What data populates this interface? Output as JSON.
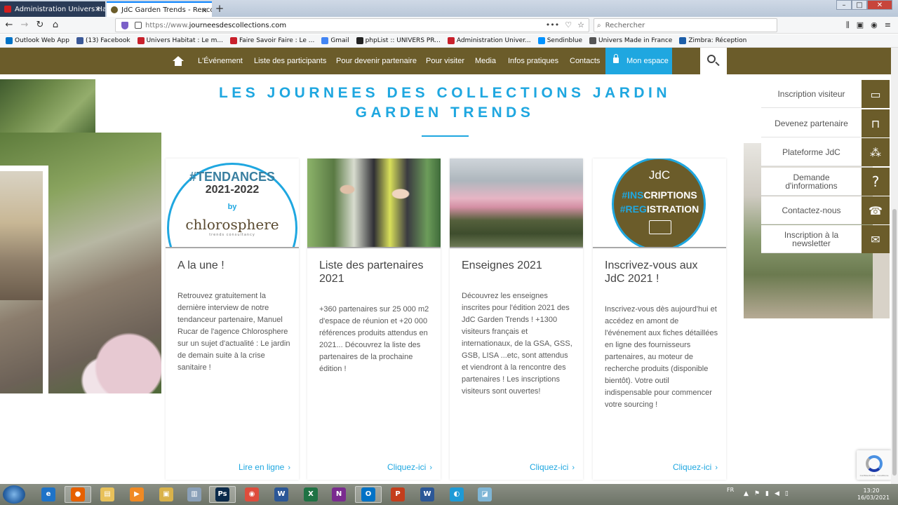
{
  "browser": {
    "tabs": [
      {
        "title": "Administration Univers Habitat",
        "close": "×"
      },
      {
        "title": "JdC Garden Trends - Rencontre",
        "close": "×"
      }
    ],
    "new_tab": "+",
    "url_proto": "https://www.",
    "url_domain": "journeesdescollections.com",
    "url_actions": [
      "•••",
      "♡",
      "☆"
    ],
    "search_placeholder": "Rechercher",
    "window_controls": [
      "–",
      "□",
      "✕"
    ],
    "bookmarks": [
      {
        "label": "Outlook Web App",
        "color": "#0072c6"
      },
      {
        "label": "(13) Facebook",
        "color": "#3b5998"
      },
      {
        "label": "Univers Habitat : Le m...",
        "color": "#c8202b"
      },
      {
        "label": "Faire Savoir Faire : Le ...",
        "color": "#c8202b"
      },
      {
        "label": "Gmail",
        "color": "#4285f4"
      },
      {
        "label": "phpList :: UNIVERS PR...",
        "color": "#222222"
      },
      {
        "label": "Administration Univer...",
        "color": "#c8202b"
      },
      {
        "label": "Sendinblue",
        "color": "#0092ff"
      },
      {
        "label": "Univers Made in France",
        "color": "#555555"
      },
      {
        "label": "Zimbra: Réception",
        "color": "#1d5ea8"
      }
    ]
  },
  "menu": {
    "items": [
      "L'Événement",
      "Liste des participants",
      "Pour devenir partenaire",
      "Pour visiter",
      "Media",
      "Infos pratiques",
      "Contacts"
    ],
    "account": "Mon espace"
  },
  "heading": {
    "line1": "LES JOURNEES DES COLLECTIONS JARDIN",
    "line2": "GARDEN TRENDS"
  },
  "cards": [
    {
      "title": "A la une !",
      "text": "Retrouvez gratuitement la dernière interview de notre tendanceur partenaire, Manuel Rucar de l'agence Chlorosphere sur un sujet d'actualité : Le jardin de demain suite à la crise sanitaire !",
      "cta": "Lire en ligne",
      "image": {
        "hash": "#TENDANCES",
        "years": "2021-2022",
        "by": "by",
        "brand": "chlorosphere",
        "sub": "trends consultancy"
      }
    },
    {
      "title": "Liste des partenaires 2021",
      "text": "+360 partenaires sur 25 000 m2 d'espace de réunion et +20 000 références produits attendus en 2021... Découvrez la liste des partenaires de la prochaine édition !",
      "cta": "Cliquez-ici"
    },
    {
      "title": "Enseignes 2021",
      "text": "Découvrez les enseignes inscrites pour l'édition 2021 des JdC Garden Trends ! +1300 visiteurs français et internationaux, de la GSA, GSS, GSB, LISA ...etc, sont attendus et viendront à la rencontre des partenaires ! Les inscriptions visiteurs sont ouvertes!",
      "cta": "Cliquez-ici"
    },
    {
      "title": "Inscrivez-vous aux JdC 2021 !",
      "text": "Inscrivez-vous dès aujourd'hui et accédez en amont de l'événement aux fiches détaillées en ligne des fournisseurs partenaires, au moteur de recherche produits (disponible bientôt). Votre outil indispensable pour commencer votre sourcing !",
      "cta": "Cliquez-ici",
      "image": {
        "logo": "JdC",
        "line1_hash": "#INS",
        "line1_rest": "CRIPTIONS",
        "line2_hash": "#REG",
        "line2_rest": "ISTRATION"
      }
    }
  ],
  "side_panel": [
    {
      "label": "Inscription visiteur",
      "icon": "id-card-icon"
    },
    {
      "label": "Devenez partenaire",
      "icon": "stand-icon"
    },
    {
      "label": "Plateforme JdC",
      "icon": "network-icon"
    },
    {
      "label": "Demande d'informations",
      "icon": "question-icon"
    },
    {
      "label": "Contactez-nous",
      "icon": "phone-icon"
    },
    {
      "label": "Inscription à la newsletter",
      "icon": "mail-icon"
    }
  ],
  "recaptcha": {
    "text": "Confidentialité - Conditions"
  },
  "taskbar": {
    "icons": [
      {
        "name": "ie",
        "glyph": "e",
        "color": "#1e73c8"
      },
      {
        "name": "firefox",
        "glyph": "●",
        "color": "#e66000",
        "active": true
      },
      {
        "name": "explorer",
        "glyph": "▤",
        "color": "#e8c15a"
      },
      {
        "name": "media",
        "glyph": "▶",
        "color": "#f08a24"
      },
      {
        "name": "archive",
        "glyph": "▣",
        "color": "#d9b24a"
      },
      {
        "name": "documents",
        "glyph": "▥",
        "color": "#8aa0b8"
      },
      {
        "name": "photoshop",
        "glyph": "Ps",
        "color": "#0b2a4a",
        "active": true
      },
      {
        "name": "chrome",
        "glyph": "◉",
        "color": "#de4c3c"
      },
      {
        "name": "word-old",
        "glyph": "W",
        "color": "#2b5797"
      },
      {
        "name": "excel",
        "glyph": "X",
        "color": "#1f7244"
      },
      {
        "name": "onenote",
        "glyph": "N",
        "color": "#7a2b8f"
      },
      {
        "name": "outlook",
        "glyph": "O",
        "color": "#0072c6",
        "active": true
      },
      {
        "name": "powerpoint",
        "glyph": "P",
        "color": "#c43e1c"
      },
      {
        "name": "word",
        "glyph": "W",
        "color": "#2b5797"
      },
      {
        "name": "edge",
        "glyph": "◐",
        "color": "#1e9ad6"
      },
      {
        "name": "notes",
        "glyph": "◪",
        "color": "#7fb6d6"
      }
    ],
    "lang": "FR",
    "time": "13:20",
    "date": "16/03/2021"
  }
}
